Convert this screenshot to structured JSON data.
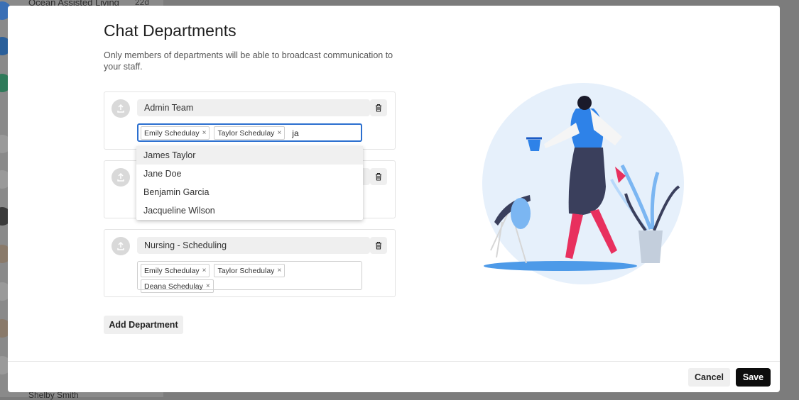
{
  "background": {
    "list_title": "Ocean Assisted Living",
    "list_days": "22d",
    "bottom_name": "Shelby Smith"
  },
  "modal": {
    "title": "Chat Departments",
    "subtitle": "Only members of departments will be able to broadcast communication to your staff."
  },
  "departments": [
    {
      "name": "Admin Team",
      "members": [
        "Emily Schedulay",
        "Taylor Schedulay"
      ],
      "search_text": "ja"
    },
    {
      "name": "",
      "members": []
    },
    {
      "name": "Nursing - Scheduling",
      "members": [
        "Emily Schedulay",
        "Taylor Schedulay",
        "Deana Schedulay"
      ]
    }
  ],
  "dropdown": {
    "options": [
      "James Taylor",
      "Jane Doe",
      "Benjamin Garcia",
      "Jacqueline Wilson"
    ],
    "highlighted": "James Taylor"
  },
  "chip_remove_glyph": "×",
  "buttons": {
    "add_department": "Add Department",
    "cancel": "Cancel",
    "save": "Save"
  },
  "icons": [
    "upload-icon",
    "trash-icon"
  ],
  "colors": {
    "focus_border": "#2b6fcf",
    "save_bg": "#0d0d0d",
    "illustration_circle": "#e6f0fb",
    "figure_blue": "#2e82e8",
    "figure_pants": "#e8305e"
  }
}
